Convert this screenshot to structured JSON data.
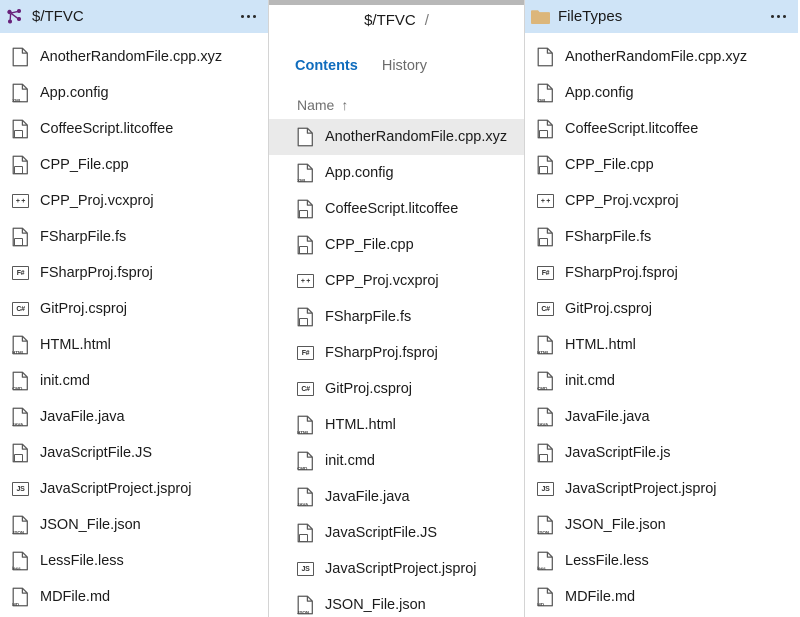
{
  "colors": {
    "header_bg": "#cfe4f7",
    "accent_blue": "#0f6cbd",
    "folder_orange": "#dcb67a",
    "tfvc_purple": "#68217a",
    "selected_row": "#eaeaea"
  },
  "left_panel": {
    "icon": "tfvc-icon",
    "title": "$/TFVC",
    "overflow_label": "more-actions",
    "files": [
      {
        "name": "AnotherRandomFile.cpp.xyz",
        "icon": "file-blank-icon",
        "badge": "",
        "boxed": false
      },
      {
        "name": "App.config",
        "icon": "file-xml-icon",
        "badge": "XML",
        "boxed": false
      },
      {
        "name": "CoffeeScript.litcoffee",
        "icon": "file-coffee-icon",
        "badge": "",
        "boxed": false
      },
      {
        "name": "CPP_File.cpp",
        "icon": "file-cpp-icon",
        "badge": "",
        "boxed": false
      },
      {
        "name": "CPP_Proj.vcxproj",
        "icon": "proj-cpp-icon",
        "badge": "+ +",
        "boxed": true
      },
      {
        "name": "FSharpFile.fs",
        "icon": "file-fsharp-icon",
        "badge": "F#",
        "boxed": false
      },
      {
        "name": "FSharpProj.fsproj",
        "icon": "proj-fsharp-icon",
        "badge": "F#",
        "boxed": true
      },
      {
        "name": "GitProj.csproj",
        "icon": "proj-csharp-icon",
        "badge": "C#",
        "boxed": true
      },
      {
        "name": "HTML.html",
        "icon": "file-html-icon",
        "badge": "HTML",
        "boxed": false
      },
      {
        "name": "init.cmd",
        "icon": "file-cmd-icon",
        "badge": "CMD",
        "boxed": false
      },
      {
        "name": "JavaFile.java",
        "icon": "file-java-icon",
        "badge": "JAVA",
        "boxed": false
      },
      {
        "name": "JavaScriptFile.JS",
        "icon": "file-js-icon",
        "badge": "JS",
        "boxed": false
      },
      {
        "name": "JavaScriptProject.jsproj",
        "icon": "proj-js-icon",
        "badge": "JS",
        "boxed": true
      },
      {
        "name": "JSON_File.json",
        "icon": "file-json-icon",
        "badge": "JSON",
        "boxed": false
      },
      {
        "name": "LessFile.less",
        "icon": "file-less-icon",
        "badge": "less",
        "boxed": false
      },
      {
        "name": "MDFile.md",
        "icon": "file-md-icon",
        "badge": "MD",
        "boxed": false
      }
    ]
  },
  "middle_panel": {
    "breadcrumb": {
      "root": "$/TFVC",
      "separator": "/"
    },
    "tabs": [
      {
        "label": "Contents",
        "active": true
      },
      {
        "label": "History",
        "active": false
      }
    ],
    "column_header": {
      "label": "Name",
      "sort_glyph": "↑"
    },
    "files": [
      {
        "name": "AnotherRandomFile.cpp.xyz",
        "icon": "file-blank-icon",
        "badge": "",
        "boxed": false,
        "selected": true
      },
      {
        "name": "App.config",
        "icon": "file-xml-icon",
        "badge": "XML",
        "boxed": false,
        "selected": false
      },
      {
        "name": "CoffeeScript.litcoffee",
        "icon": "file-coffee-icon",
        "badge": "",
        "boxed": false,
        "selected": false
      },
      {
        "name": "CPP_File.cpp",
        "icon": "file-cpp-icon",
        "badge": "",
        "boxed": false,
        "selected": false
      },
      {
        "name": "CPP_Proj.vcxproj",
        "icon": "proj-cpp-icon",
        "badge": "+ +",
        "boxed": true,
        "selected": false
      },
      {
        "name": "FSharpFile.fs",
        "icon": "file-fsharp-icon",
        "badge": "F#",
        "boxed": false,
        "selected": false
      },
      {
        "name": "FSharpProj.fsproj",
        "icon": "proj-fsharp-icon",
        "badge": "F#",
        "boxed": true,
        "selected": false
      },
      {
        "name": "GitProj.csproj",
        "icon": "proj-csharp-icon",
        "badge": "C#",
        "boxed": true,
        "selected": false
      },
      {
        "name": "HTML.html",
        "icon": "file-html-icon",
        "badge": "HTML",
        "boxed": false,
        "selected": false
      },
      {
        "name": "init.cmd",
        "icon": "file-cmd-icon",
        "badge": "CMD",
        "boxed": false,
        "selected": false
      },
      {
        "name": "JavaFile.java",
        "icon": "file-java-icon",
        "badge": "JAVA",
        "boxed": false,
        "selected": false
      },
      {
        "name": "JavaScriptFile.JS",
        "icon": "file-js-icon",
        "badge": "JS",
        "boxed": false,
        "selected": false
      },
      {
        "name": "JavaScriptProject.jsproj",
        "icon": "proj-js-icon",
        "badge": "JS",
        "boxed": true,
        "selected": false
      },
      {
        "name": "JSON_File.json",
        "icon": "file-json-icon",
        "badge": "JSON",
        "boxed": false,
        "selected": false
      }
    ]
  },
  "right_panel": {
    "icon": "folder-icon",
    "title": "FileTypes",
    "overflow_label": "more-actions",
    "files": [
      {
        "name": "AnotherRandomFile.cpp.xyz",
        "icon": "file-blank-icon",
        "badge": "",
        "boxed": false
      },
      {
        "name": "App.config",
        "icon": "file-xml-icon",
        "badge": "XML",
        "boxed": false
      },
      {
        "name": "CoffeeScript.litcoffee",
        "icon": "file-coffee-icon",
        "badge": "",
        "boxed": false
      },
      {
        "name": "CPP_File.cpp",
        "icon": "file-cpp-icon",
        "badge": "",
        "boxed": false
      },
      {
        "name": "CPP_Proj.vcxproj",
        "icon": "proj-cpp-icon",
        "badge": "+ +",
        "boxed": true
      },
      {
        "name": "FSharpFile.fs",
        "icon": "file-fsharp-icon",
        "badge": "F#",
        "boxed": false
      },
      {
        "name": "FSharpProj.fsproj",
        "icon": "proj-fsharp-icon",
        "badge": "F#",
        "boxed": true
      },
      {
        "name": "GitProj.csproj",
        "icon": "proj-csharp-icon",
        "badge": "C#",
        "boxed": true
      },
      {
        "name": "HTML.html",
        "icon": "file-html-icon",
        "badge": "HTML",
        "boxed": false
      },
      {
        "name": "init.cmd",
        "icon": "file-cmd-icon",
        "badge": "CMD",
        "boxed": false
      },
      {
        "name": "JavaFile.java",
        "icon": "file-java-icon",
        "badge": "JAVA",
        "boxed": false
      },
      {
        "name": "JavaScriptFile.js",
        "icon": "file-js-icon",
        "badge": "JS",
        "boxed": false
      },
      {
        "name": "JavaScriptProject.jsproj",
        "icon": "proj-js-icon",
        "badge": "JS",
        "boxed": true
      },
      {
        "name": "JSON_File.json",
        "icon": "file-json-icon",
        "badge": "JSON",
        "boxed": false
      },
      {
        "name": "LessFile.less",
        "icon": "file-less-icon",
        "badge": "less",
        "boxed": false
      },
      {
        "name": "MDFile.md",
        "icon": "file-md-icon",
        "badge": "MD",
        "boxed": false
      }
    ]
  }
}
